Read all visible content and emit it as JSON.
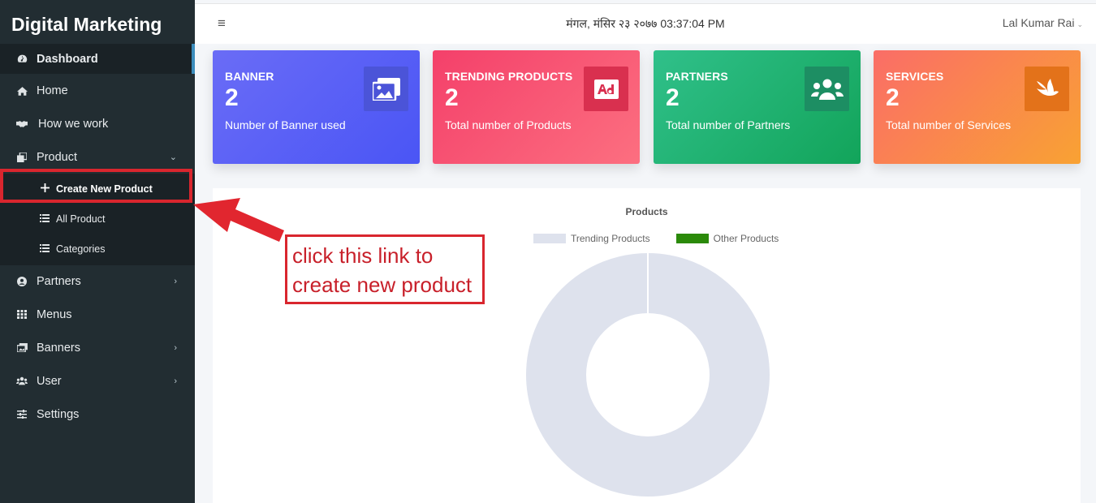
{
  "sidebar": {
    "brand": "Digital Marketing",
    "items": [
      {
        "label": "Dashboard",
        "icon": "dashboard-icon"
      },
      {
        "label": "Home",
        "icon": "home-icon"
      },
      {
        "label": "How we work",
        "icon": "handshake-icon"
      },
      {
        "label": "Product",
        "icon": "clone-icon"
      },
      {
        "label": "Partners",
        "icon": "user-circle-icon"
      },
      {
        "label": "Menus",
        "icon": "grid-icon"
      },
      {
        "label": "Banners",
        "icon": "images-icon"
      },
      {
        "label": "User",
        "icon": "users-icon"
      },
      {
        "label": "Settings",
        "icon": "sliders-icon"
      }
    ],
    "product_submenu": [
      {
        "label": "Create New Product",
        "icon": "plus-icon"
      },
      {
        "label": "All Product",
        "icon": "list-icon"
      },
      {
        "label": "Categories",
        "icon": "list-icon"
      }
    ]
  },
  "topbar": {
    "datetime": "मंगल, मंसिर २३ २०७७ 03:37:04 PM",
    "user": "Lal Kumar Rai"
  },
  "cards": [
    {
      "title": "BANNER",
      "count": "2",
      "subtitle": "Number of Banner used",
      "icon": "images-icon"
    },
    {
      "title": "TRENDING PRODUCTS",
      "count": "2",
      "subtitle": "Total number of Products",
      "icon": "ad-icon"
    },
    {
      "title": "PARTNERS",
      "count": "2",
      "subtitle": "Total number of Partners",
      "icon": "users-icon"
    },
    {
      "title": "SERVICES",
      "count": "2",
      "subtitle": "Total number of Services",
      "icon": "dove-icon"
    }
  ],
  "chart_data": {
    "type": "pie",
    "title": "Products",
    "categories": [
      "Trending Products",
      "Other Products"
    ],
    "values": [
      2,
      0
    ],
    "colors": [
      "#dee2ed",
      "#2b8a0a"
    ],
    "legend": "top"
  },
  "annotation": {
    "line1": "click this link to",
    "line2": "create new product",
    "color": "#d9262e"
  }
}
